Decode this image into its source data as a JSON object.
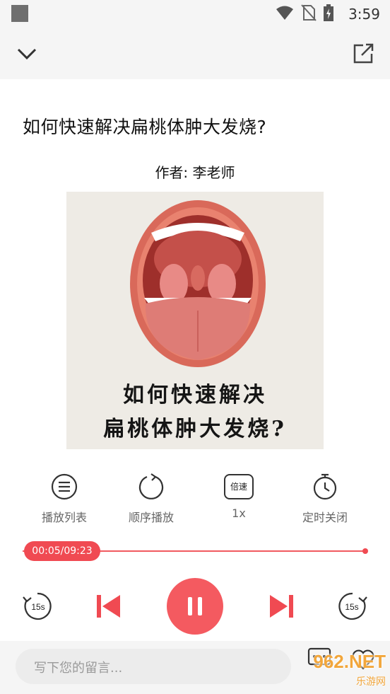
{
  "status_bar": {
    "time": "3:59"
  },
  "article": {
    "title": "如何快速解决扁桃体肿大发烧?",
    "author": "作者: 李老师"
  },
  "cover": {
    "caption_line1": "如何快速解决",
    "caption_line2": "扁桃体肿大发烧?"
  },
  "controls": [
    {
      "label": "播放列表",
      "icon": "playlist-icon"
    },
    {
      "label": "顺序播放",
      "icon": "repeat-icon"
    },
    {
      "label": "1x",
      "icon": "speed-icon",
      "icon_text": "倍速"
    },
    {
      "label": "定时关闭",
      "icon": "timer-icon"
    }
  ],
  "player": {
    "position_text": "00:05/09:23",
    "progress": 0.01,
    "rewind_label": "15s",
    "forward_label": "15s",
    "state": "playing"
  },
  "comment": {
    "placeholder": "写下您的留言..."
  },
  "watermark": {
    "brand": "962.NET",
    "sub": "乐游网"
  },
  "colors": {
    "accent": "#f04a52",
    "bar_bg": "#f5f5f5",
    "label_gray": "#666666"
  }
}
